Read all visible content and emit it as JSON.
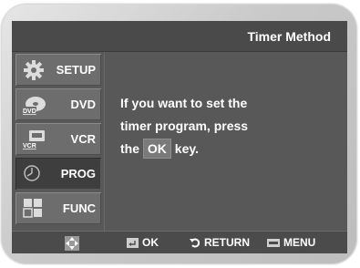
{
  "header": {
    "title": "Timer Method"
  },
  "sidebar": {
    "items": [
      {
        "label": "SETUP",
        "icon": "gear-icon",
        "active": false
      },
      {
        "label": "DVD",
        "icon": "dvd-disc-icon",
        "active": false
      },
      {
        "label": "VCR",
        "icon": "vcr-cassette-icon",
        "active": false
      },
      {
        "label": "PROG",
        "icon": "clock-icon",
        "active": true
      },
      {
        "label": "FUNC",
        "icon": "function-grid-icon",
        "active": false
      }
    ]
  },
  "message": {
    "line1": "If you want to set the",
    "line2": "timer program, press",
    "line3_prefix": "the",
    "key": "OK",
    "line3_suffix": "key."
  },
  "bottom_bar": {
    "ok_label": "OK",
    "return_label": "RETURN",
    "menu_label": "MENU"
  },
  "colors": {
    "screen_bg": "#585858",
    "title_bg": "#4a4a4a",
    "tab_bg": "#6d6d6d",
    "tab_active_bg": "#3e3e3e",
    "frame": "#c9c9c9",
    "text": "#ffffff"
  }
}
